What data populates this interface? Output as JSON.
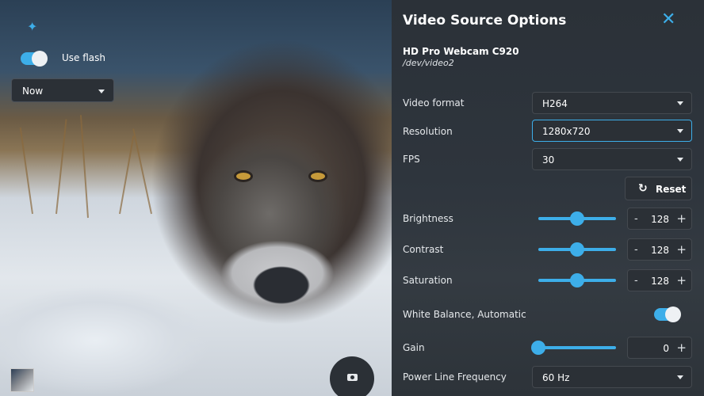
{
  "camera": {
    "flash_label": "Use flash",
    "flash_enabled": true,
    "timer_value": "Now"
  },
  "panel": {
    "title": "Video Source Options",
    "device_name": "HD Pro Webcam C920",
    "device_path": "/dev/video2",
    "video_format": {
      "label": "Video format",
      "value": "H264"
    },
    "resolution": {
      "label": "Resolution",
      "value": "1280x720"
    },
    "fps": {
      "label": "FPS",
      "value": "30"
    },
    "reset_label": "Reset",
    "brightness": {
      "label": "Brightness",
      "value": "128",
      "level": 0.5
    },
    "contrast": {
      "label": "Contrast",
      "value": "128",
      "level": 0.5
    },
    "saturation": {
      "label": "Saturation",
      "value": "128",
      "level": 0.5
    },
    "white_balance": {
      "label": "White Balance, Automatic",
      "enabled": true
    },
    "gain": {
      "label": "Gain",
      "value": "0",
      "level": 0
    },
    "power_line": {
      "label": "Power Line Frequency",
      "value": "60 Hz"
    },
    "spin_minus": "-",
    "spin_plus": "+"
  },
  "colors": {
    "accent": "#3daee9",
    "panel_bg": "#2e353d",
    "field_bg": "#2b3036"
  },
  "icons": [
    "magic-wand-icon",
    "close-icon",
    "reset-icon",
    "camera-icon",
    "chevron-down-icon"
  ]
}
